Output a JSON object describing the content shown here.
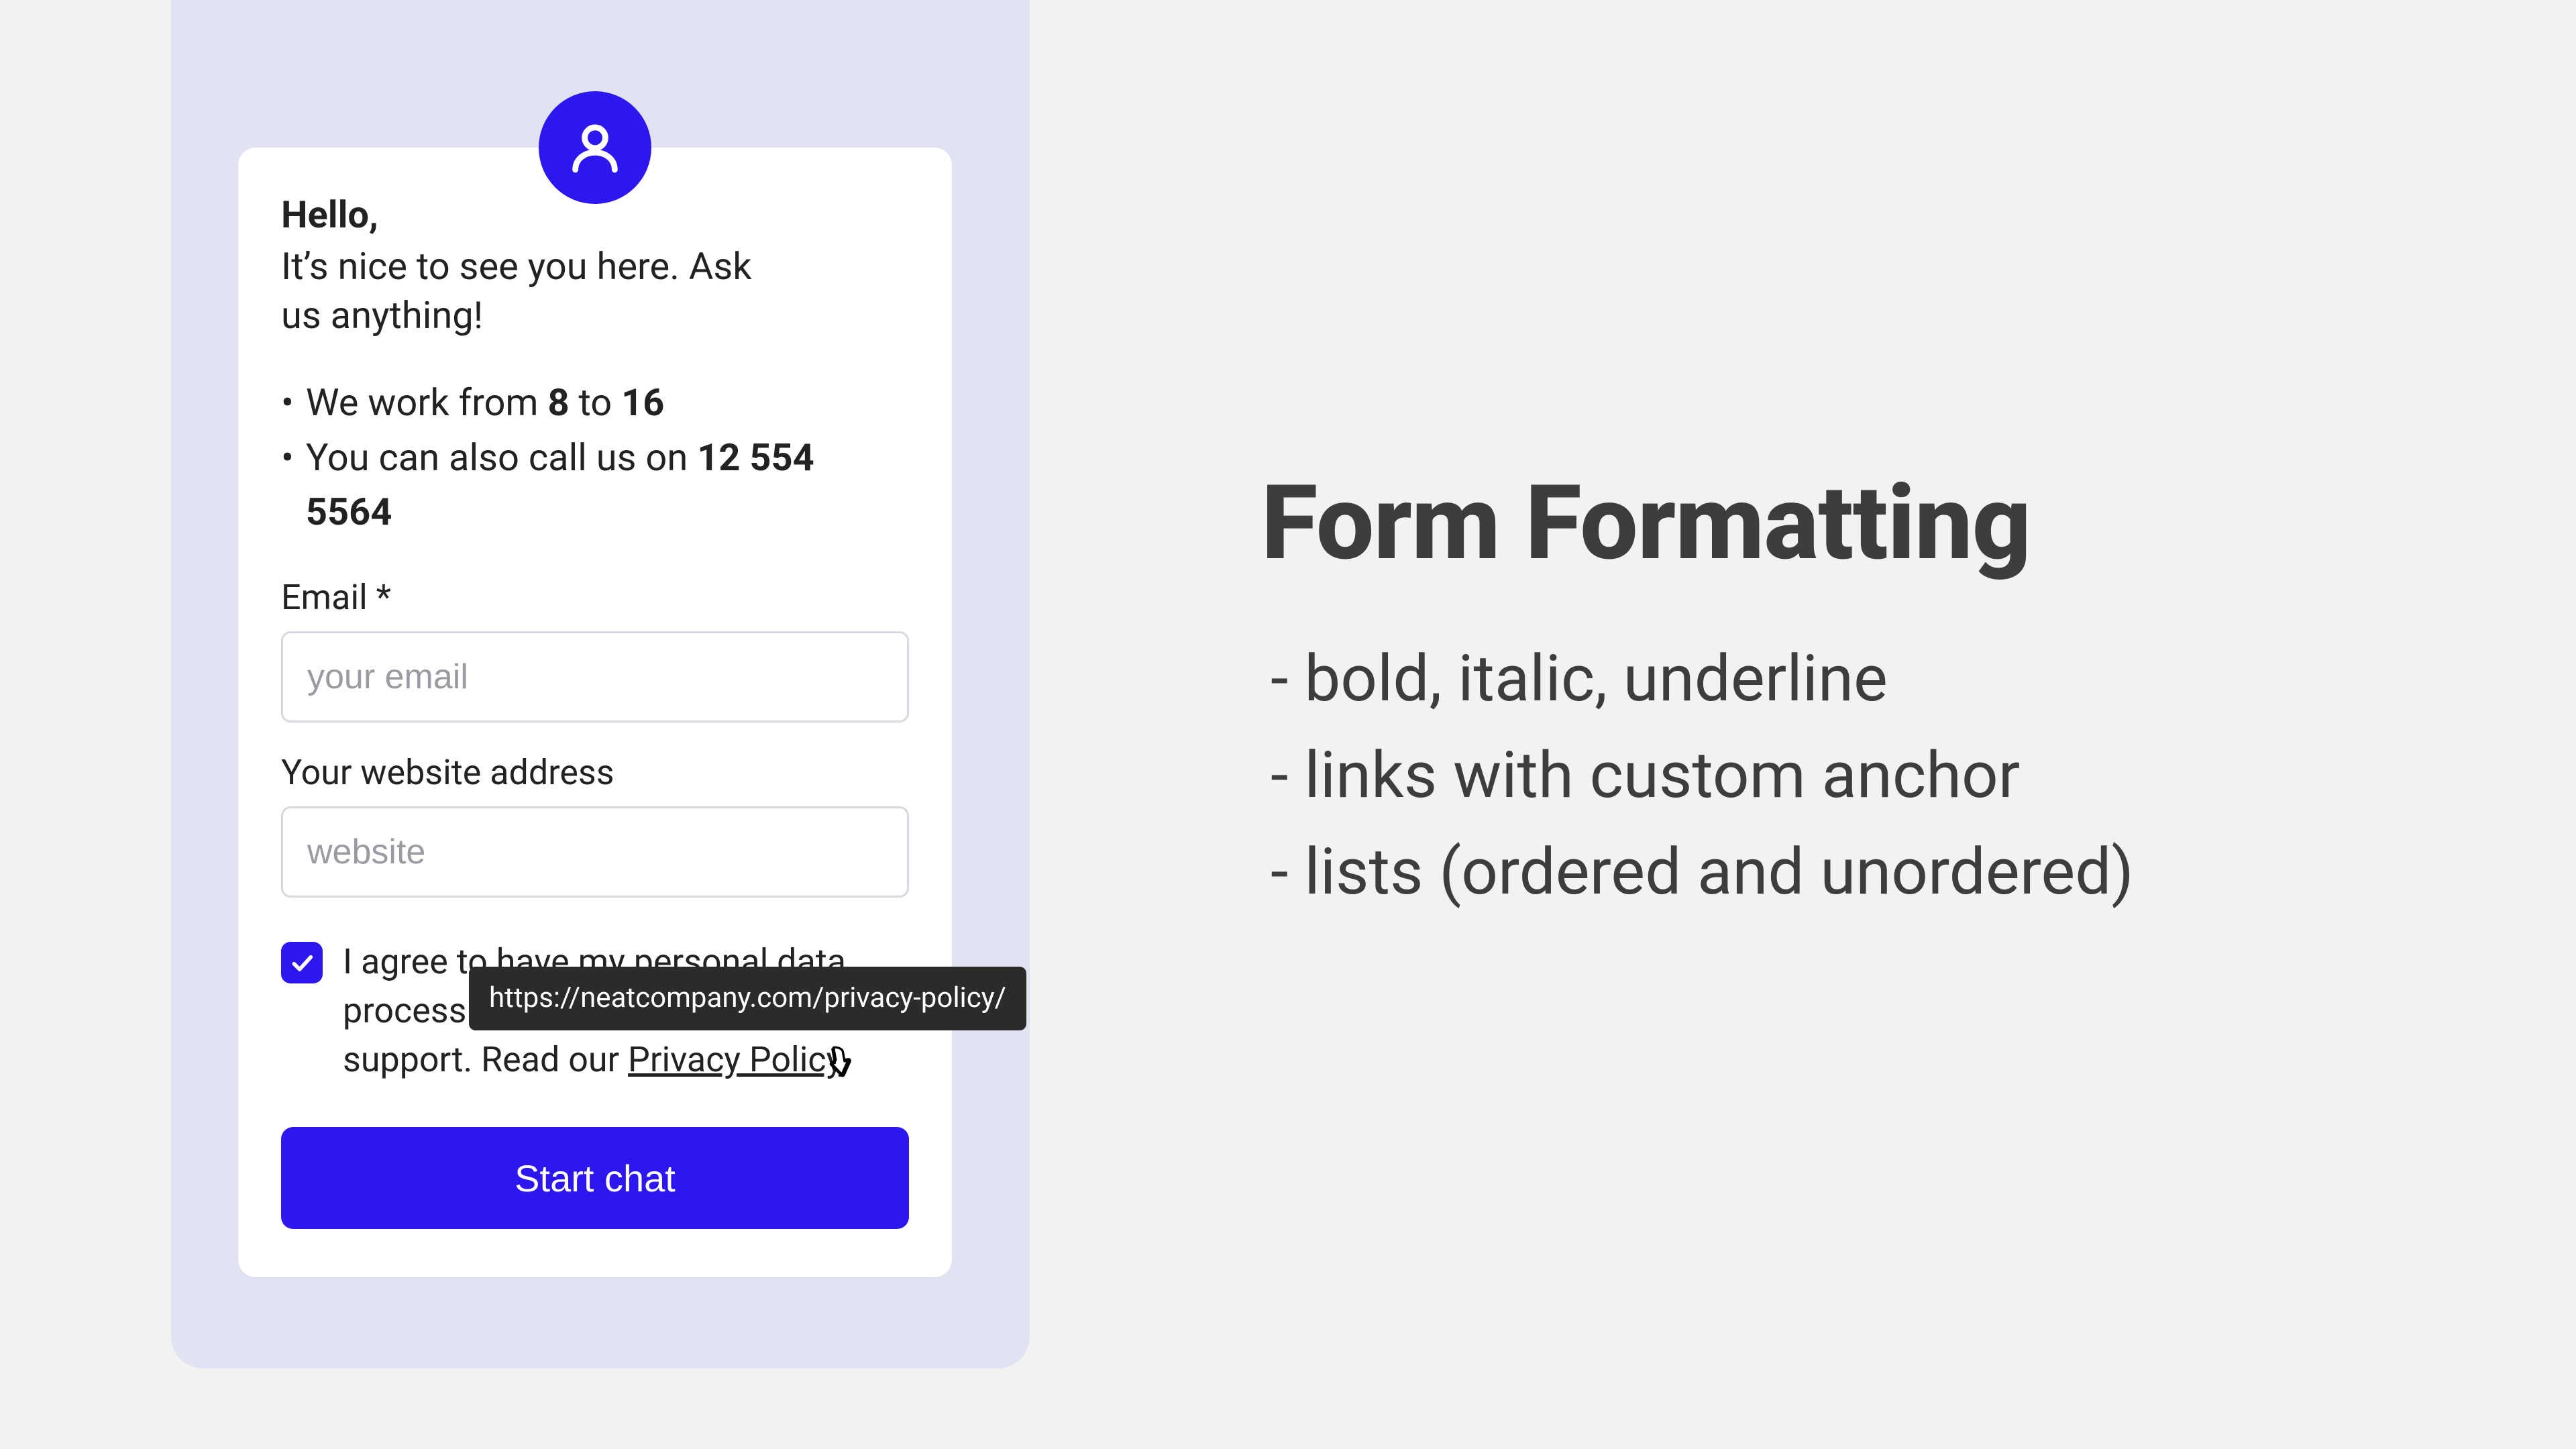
{
  "colors": {
    "accent": "#2c17ef",
    "panel": "#e2e3f2",
    "text": "#222",
    "headline": "#3d3d3d"
  },
  "avatar_icon": "user-icon",
  "greeting": {
    "hello": "Hello,",
    "subtitle": "It’s nice to see you here. Ask us anything!"
  },
  "info_bullets": {
    "line1_prefix": "We work from ",
    "line1_bold1": "8",
    "line1_mid": " to ",
    "line1_bold2": "16",
    "line2_prefix": "You can also call us on  ",
    "line2_bold": "12 554 5564"
  },
  "form": {
    "email_label": "Email *",
    "email_placeholder": "your email",
    "website_label": "Your website address",
    "website_placeholder": "website"
  },
  "consent": {
    "checked": true,
    "line1": "I agree to have my personal data",
    "line2_prefix": "process",
    "line3_prefix": "support. Read our ",
    "link_text": "Privacy Policy",
    "tooltip_url": "https://neatcompany.com/privacy-policy/"
  },
  "button_label": "Start chat",
  "right": {
    "headline": "Form Formatting",
    "features": [
      "- bold, italic, underline",
      "- links with custom anchor",
      "- lists (ordered and unordered)"
    ]
  }
}
